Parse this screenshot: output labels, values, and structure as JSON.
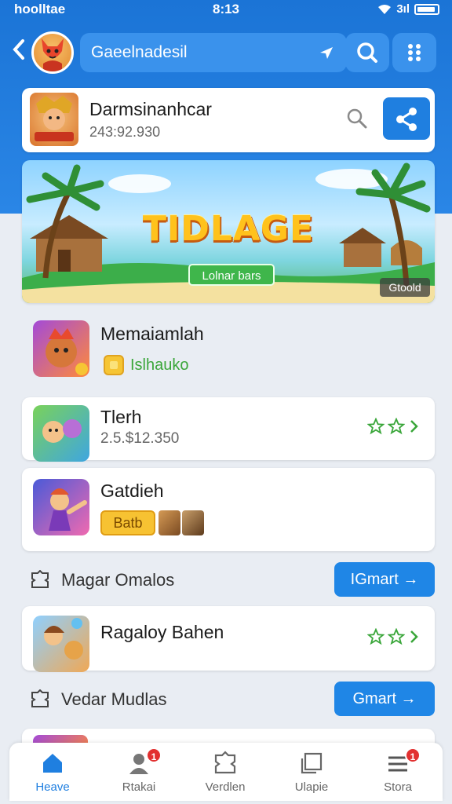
{
  "status": {
    "left": "hoolltae",
    "time": "8:13",
    "signal": "3ıl"
  },
  "appbar": {
    "search_text": "Gaeelnadesil"
  },
  "profile": {
    "name": "Darmsinanhcar",
    "sub": "243:92.930"
  },
  "banner": {
    "title": "TIDLAGE",
    "button": "Lolnar bars",
    "tag": "Gtoold"
  },
  "items": [
    {
      "title": "Memaiamlah",
      "sub": "Islhauko"
    },
    {
      "title": "Tlerh",
      "sub": "2.5.$12.350"
    },
    {
      "title": "Gatdieh",
      "badge": "Batb"
    },
    {
      "title": "Ragaloy Bahen"
    }
  ],
  "sections": [
    {
      "label": "Magar Omalos",
      "button": "IGmart →"
    },
    {
      "label": "Vedar Mudlas",
      "button": "Gmart →"
    }
  ],
  "tabs": [
    {
      "label": "Heave",
      "badge": ""
    },
    {
      "label": "Rtakai",
      "badge": "1"
    },
    {
      "label": "Verdlen",
      "badge": ""
    },
    {
      "label": "Ulapie",
      "badge": ""
    },
    {
      "label": "Stora",
      "badge": "1"
    }
  ],
  "colors": {
    "primary": "#1f7fe0",
    "green": "#3aa63a",
    "badge": "#e23030"
  }
}
